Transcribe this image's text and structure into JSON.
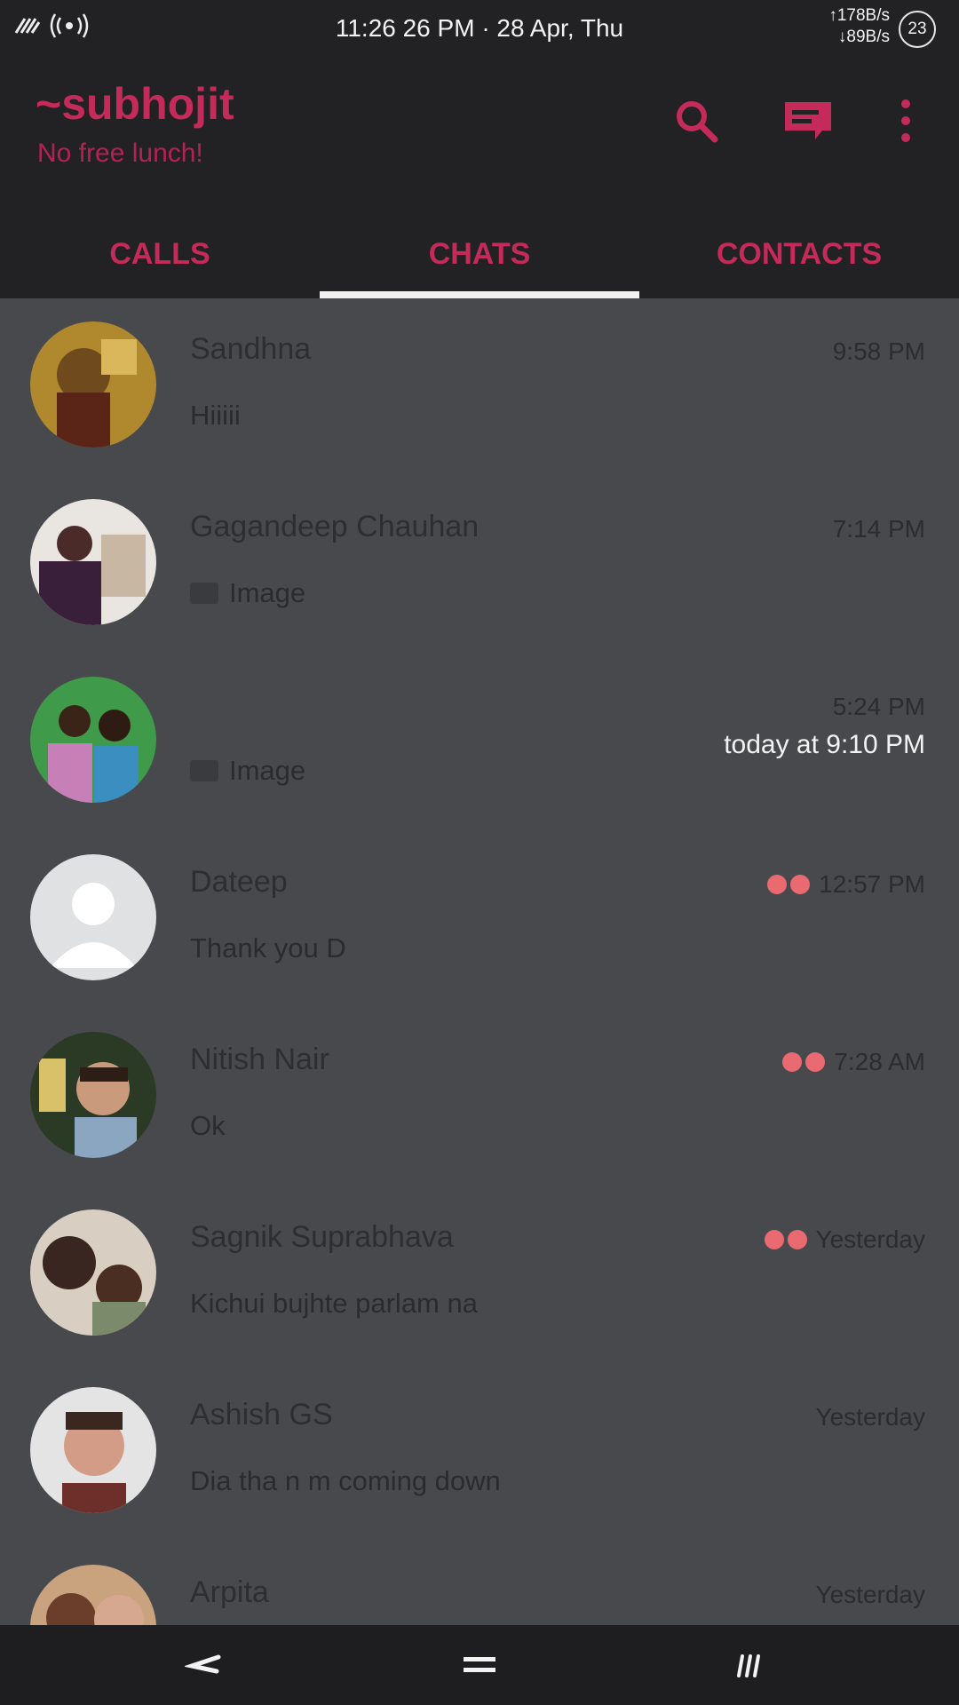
{
  "status_bar": {
    "clock": "11:26 26 PM · 28 Apr, Thu",
    "upload_speed": "↑178B/s",
    "download_speed": "↓89B/s",
    "battery": "23",
    "icons": [
      "no-signal-icon",
      "hotspot-icon"
    ]
  },
  "header": {
    "title": "~subhojit",
    "subtitle": "No free lunch!",
    "actions": [
      "search-icon",
      "new-chat-icon",
      "overflow-menu-icon"
    ],
    "accent_color": "#c42a5a"
  },
  "tabs": [
    {
      "label": "CALLS",
      "active": false
    },
    {
      "label": "CHATS",
      "active": true
    },
    {
      "label": "CONTACTS",
      "active": false
    }
  ],
  "chats": [
    {
      "name": "Sandhna",
      "time": "9:58 PM",
      "message": "Hiiiii",
      "image": false,
      "read_dots": false,
      "sub": ""
    },
    {
      "name": "Gagandeep Chauhan",
      "time": "7:14 PM",
      "message": "Image",
      "image": true,
      "read_dots": false,
      "sub": ""
    },
    {
      "name": "",
      "time": "5:24 PM",
      "message": "Image",
      "image": true,
      "read_dots": false,
      "sub": "today at 9:10 PM"
    },
    {
      "name": "Dateep",
      "time": "12:57 PM",
      "message": "Thank you D",
      "image": false,
      "read_dots": true,
      "sub": ""
    },
    {
      "name": "Nitish Nair",
      "time": "7:28 AM",
      "message": "Ok",
      "image": false,
      "read_dots": true,
      "sub": ""
    },
    {
      "name": "Sagnik Suprabhava",
      "time": "Yesterday",
      "message": "Kichui bujhte parlam na",
      "image": false,
      "read_dots": true,
      "sub": ""
    },
    {
      "name": "Ashish GS",
      "time": "Yesterday",
      "message": "Dia tha n m coming down",
      "image": false,
      "read_dots": false,
      "sub": ""
    },
    {
      "name": "Arpita",
      "time": "Yesterday",
      "message": "",
      "image": false,
      "read_dots": false,
      "sub": ""
    }
  ],
  "nav_bar": {
    "buttons": [
      "back-icon",
      "home-icon",
      "recents-icon"
    ]
  }
}
